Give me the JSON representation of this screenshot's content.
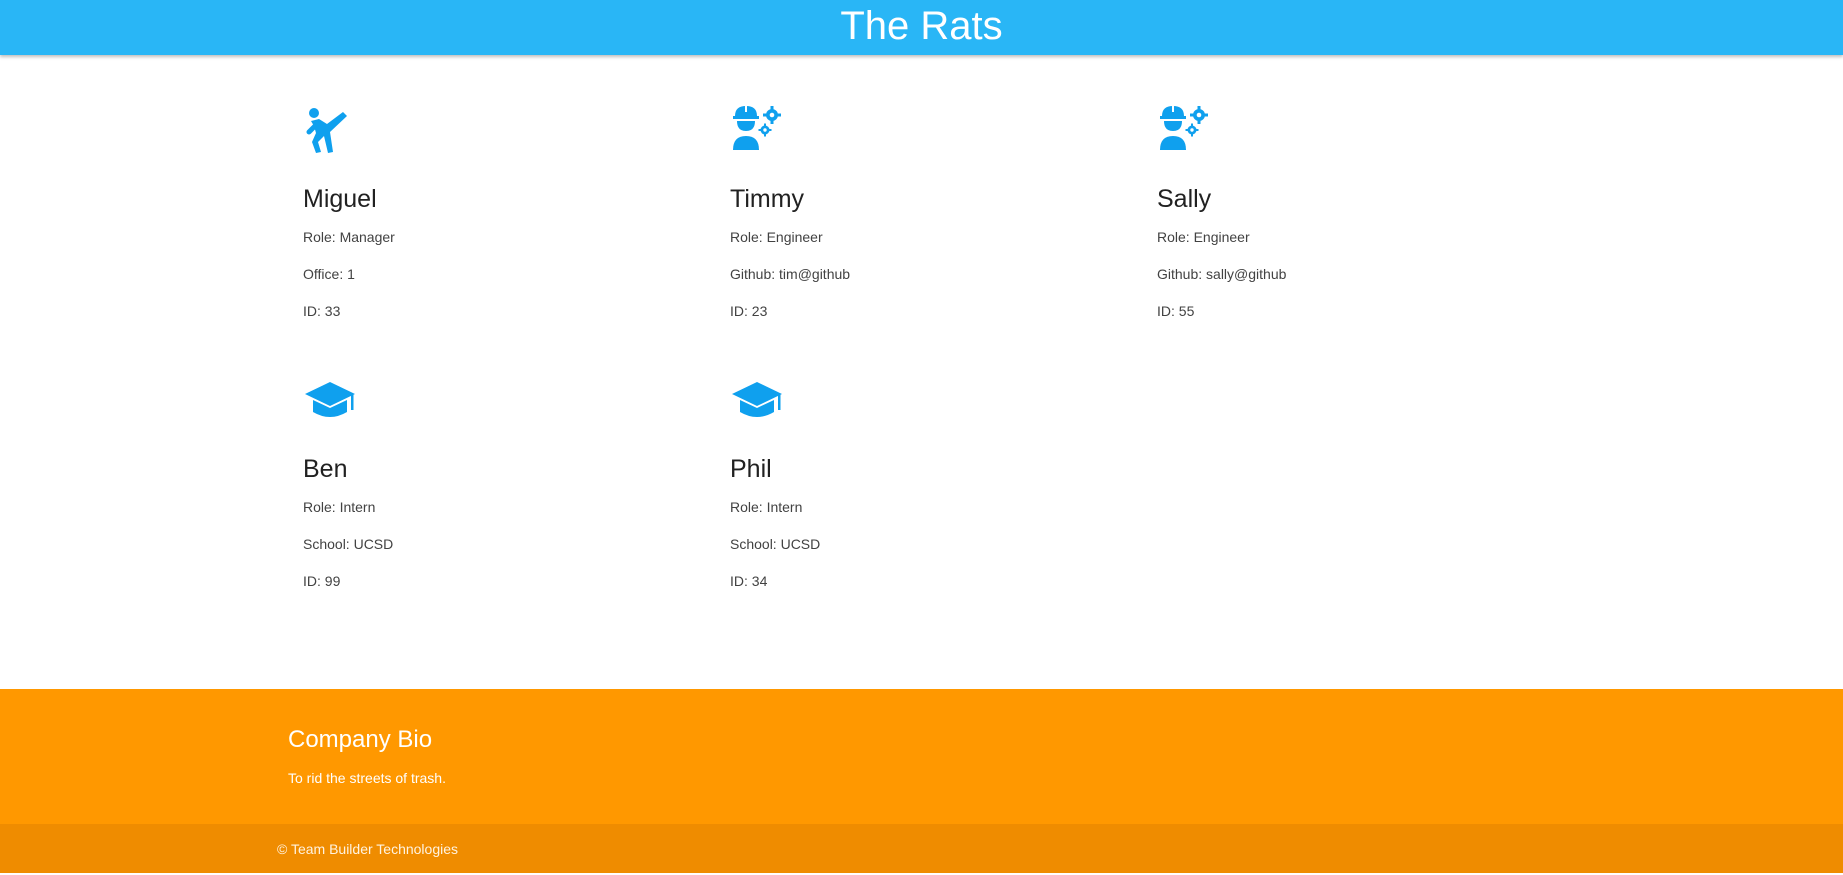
{
  "header": {
    "title": "The Rats"
  },
  "team": [
    {
      "icon": "karate-kick-icon",
      "name": "Miguel",
      "role": "Role: Manager",
      "detail": "Office: 1",
      "id": "ID: 33"
    },
    {
      "icon": "engineer-gears-icon",
      "name": "Timmy",
      "role": "Role: Engineer",
      "detail": "Github: tim@github",
      "id": "ID: 23"
    },
    {
      "icon": "engineer-gears-icon",
      "name": "Sally",
      "role": "Role: Engineer",
      "detail": "Github: sally@github",
      "id": "ID: 55"
    },
    {
      "icon": "graduation-cap-icon",
      "name": "Ben",
      "role": "Role: Intern",
      "detail": "School: UCSD",
      "id": "ID: 99"
    },
    {
      "icon": "graduation-cap-icon",
      "name": "Phil",
      "role": "Role: Intern",
      "detail": "School: UCSD",
      "id": "ID: 34"
    }
  ],
  "footer": {
    "heading": "Company Bio",
    "bio": "To rid the streets of trash.",
    "copyright": "© Team Builder Technologies"
  },
  "colors": {
    "header": "#29b6f6",
    "icon": "#0fa0ee",
    "footer": "#ff9800",
    "footer_bottom": "#ef8c00"
  }
}
